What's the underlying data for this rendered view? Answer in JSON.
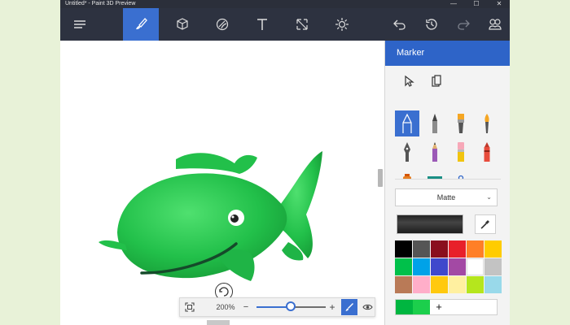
{
  "window": {
    "title": "Untitled* - Paint 3D Preview",
    "controls": {
      "minimize": "—",
      "maximize": "☐",
      "close": "✕"
    }
  },
  "toolbar": {
    "items": [
      {
        "name": "menu",
        "icon": "hamburger-icon"
      },
      {
        "name": "brushes",
        "icon": "brush-icon",
        "active": true
      },
      {
        "name": "3d-objects",
        "icon": "cube-icon"
      },
      {
        "name": "stickers",
        "icon": "sticker-icon"
      },
      {
        "name": "text",
        "icon": "text-icon"
      },
      {
        "name": "canvas",
        "icon": "resize-icon"
      },
      {
        "name": "effects",
        "icon": "sun-icon"
      },
      {
        "name": "undo",
        "icon": "undo-icon"
      },
      {
        "name": "history",
        "icon": "history-icon"
      },
      {
        "name": "redo",
        "icon": "redo-icon"
      },
      {
        "name": "remix",
        "icon": "remix-icon"
      }
    ]
  },
  "panel": {
    "title": "Marker",
    "finish": {
      "selected": "Matte",
      "chevron": "⌄"
    },
    "colors": {
      "palette": [
        "#000000",
        "#555555",
        "#8a0f1e",
        "#e8202a",
        "#ff7f27",
        "#ffcc00",
        "#00c04a",
        "#00a2e8",
        "#3f48cc",
        "#a349a4",
        "#ffffff",
        "#c3c3c3",
        "#b97a57",
        "#ffaec9",
        "#ffc90e",
        "#fff0a0",
        "#b5e61d",
        "#99d9ea"
      ],
      "recent": [
        "#00b640",
        "#1ccf4c"
      ],
      "add_label": "+"
    }
  },
  "zoom": {
    "level": "200%",
    "minus": "−",
    "plus": "+",
    "slider_fraction": 0.43
  },
  "accent": "#3a6fd0",
  "object_color": "#22c04a"
}
